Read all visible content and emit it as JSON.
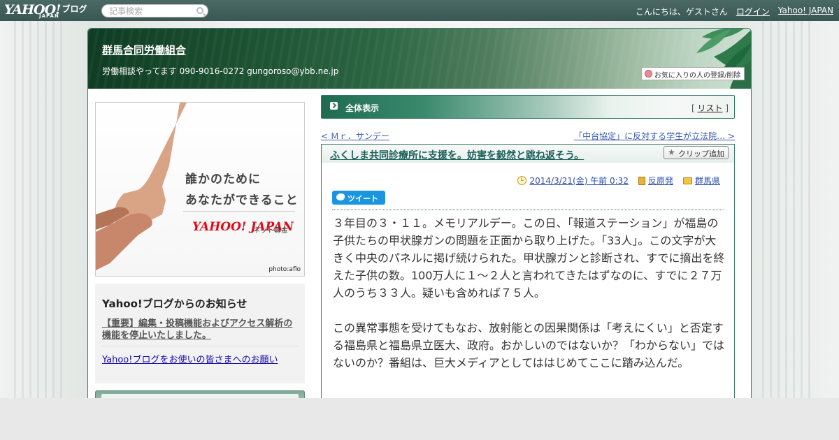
{
  "topbar": {
    "logo_text": "YAHOO!",
    "logo_japan": "JAPAN",
    "logo_blog": "ブログ",
    "search_placeholder": "記事検索",
    "greeting": "こんにちは、ゲストさん",
    "login": "ログイン",
    "yahoo_japan": "Yahoo! JAPAN"
  },
  "header": {
    "blog_title": "群馬合同労働組合",
    "blog_desc": "労働相談やってます 090-9016-0272 gungoroso@ybb.ne.jp",
    "favorite_button": "お気に入りの人の登録/削除"
  },
  "sidebar": {
    "banner_line1": "誰かのために",
    "banner_line2": "あなたができること",
    "banner_logo": "YAHOO! JAPAN",
    "banner_sub": "ネット募金",
    "banner_credit": "photo:aflo",
    "notice_title": "Yahoo!ブログからのお知らせ",
    "notice_item1": "【重要】編集・投稿機能およびアクセス解析の機能を停止いたしました。",
    "notice_item2": "Yahoo!ブログをお使いの皆さまへのお願い"
  },
  "content": {
    "all_label": "全体表示",
    "list_open": "[",
    "list_link": "リスト",
    "list_close": "]",
    "prev_link": "< Ｍｒ．サンデー",
    "next_link": "「中台協定」に反対する学生が立法院… >",
    "article": {
      "title": "ふくしま共同診療所に支援を。妨害を毅然と跳ね返そう。",
      "clip_button": "クリップ追加",
      "date": "2014/3/21(金) 午前 0:32",
      "category1": "反原発",
      "category2": "群馬県",
      "tweet": "ツイート",
      "paragraph1": "３年目の３・１１。メモリアルデー。この日、「報道ステーション」が福島の子供たちの甲状腺ガンの問題を正面から取り上げた。「33人」。この文字が大きく中央のパネルに掲げ続けられた。甲状腺ガンと診断され、すでに摘出を終えた子供の数。100万人に１～２人と言われてきたはずなのに、すでに２７万人のうち３３人。疑いも含めれば７５人。",
      "paragraph2": "この異常事態を受けてもなお、放射能との因果関係は「考えにくい」と否定する福島県と福島県立医大、政府。おかしいのではないか？「わからない」ではないのか？番組は、巨大メディアとしてははじめてここに踏み込んだ。"
    }
  }
}
